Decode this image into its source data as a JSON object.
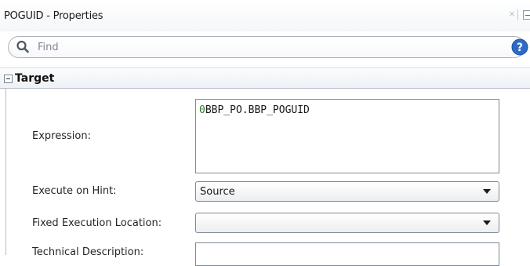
{
  "window": {
    "title": "POGUID - Properties",
    "close_glyph": "×"
  },
  "search": {
    "placeholder": "Find",
    "value": ""
  },
  "section": {
    "title": "Target"
  },
  "fields": {
    "expression": {
      "label": "Expression:",
      "value_lead": "0",
      "value_rest": "BBP_PO.BBP_POGUID"
    },
    "execute_on_hint": {
      "label": "Execute on Hint:",
      "value": "Source"
    },
    "fixed_execution_location": {
      "label": "Fixed Execution Location:",
      "value": ""
    },
    "technical_description": {
      "label": "Technical Description:",
      "value": ""
    }
  },
  "icons": {
    "search": "search-icon",
    "help": "help-icon",
    "collapse": "collapse-icon",
    "dropdown": "chevron-down-icon"
  },
  "colors": {
    "help_blue": "#2d6bc4",
    "expression_lead_green": "#2f7a2f"
  }
}
